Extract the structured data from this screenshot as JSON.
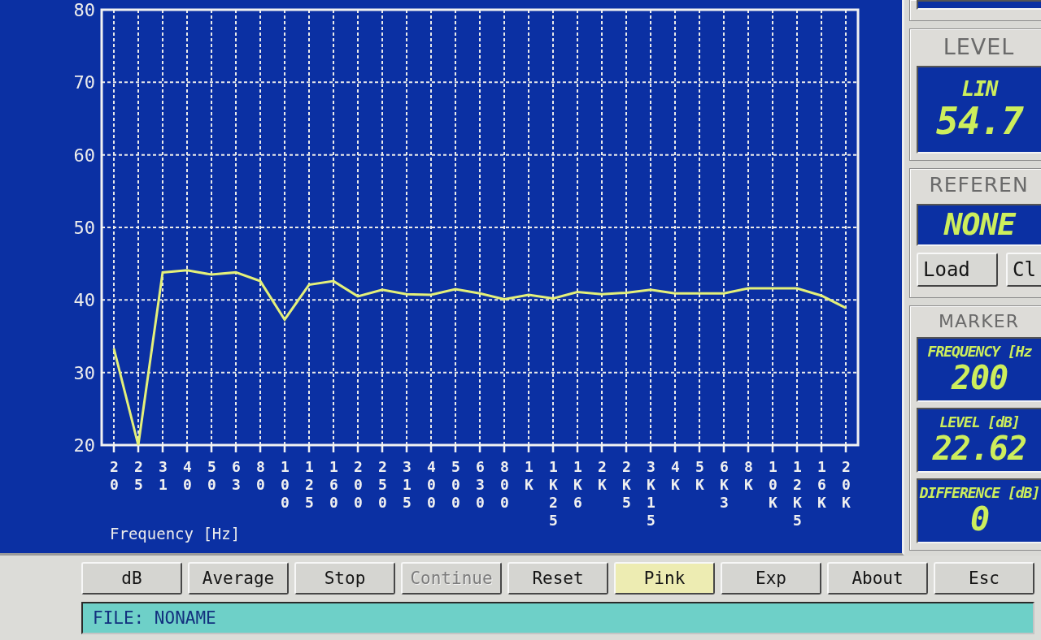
{
  "spectrum": {
    "chart_data": {
      "type": "line",
      "xlabel": "Frequency [Hz]",
      "categories": [
        "20",
        "25",
        "31",
        "40",
        "50",
        "63",
        "80",
        "100",
        "125",
        "160",
        "200",
        "250",
        "315",
        "400",
        "500",
        "630",
        "800",
        "1K",
        "1K25",
        "1K6",
        "2K",
        "2K5",
        "3K15",
        "4K",
        "5K",
        "6K3",
        "8K",
        "10K",
        "12K5",
        "16K",
        "20K"
      ],
      "series": [
        {
          "color": "#e4f07a",
          "values": [
            33.3,
            20,
            43.8,
            44.1,
            43.5,
            43.8,
            42.6,
            37.3,
            42.1,
            42.6,
            40.5,
            41.4,
            40.8,
            40.7,
            41.5,
            40.9,
            40.1,
            40.7,
            40.2,
            41.1,
            40.8,
            41.0,
            41.4,
            40.9,
            40.9,
            40.9,
            41.6,
            41.6,
            41.6,
            40.6,
            38.9
          ]
        }
      ],
      "ylim": [
        20,
        80
      ],
      "yticks": [
        20,
        30,
        40,
        50,
        60,
        70,
        80
      ],
      "grid": true
    }
  },
  "level_panel": {
    "title": "LEVEL",
    "mode": "LIN",
    "value": "54.7"
  },
  "reference_panel": {
    "title": "REFEREN",
    "value": "NONE",
    "buttons": [
      {
        "label": "Load"
      },
      {
        "label": "Cl"
      }
    ]
  },
  "marker_panel": {
    "title": "MARKER",
    "readouts": [
      {
        "label": "FREQUENCY [Hz",
        "value": "200"
      },
      {
        "label": "LEVEL [dB]",
        "value": "22.62"
      },
      {
        "label": "DIFFERENCE [dB]",
        "value": "0"
      }
    ]
  },
  "toolbar": {
    "buttons": [
      {
        "label": "dB",
        "selected": false,
        "disabled": false
      },
      {
        "label": "Average",
        "selected": false,
        "disabled": false
      },
      {
        "label": "Stop",
        "selected": false,
        "disabled": false
      },
      {
        "label": "Continue",
        "selected": false,
        "disabled": true
      },
      {
        "label": "Reset",
        "selected": false,
        "disabled": false
      },
      {
        "label": "Pink",
        "selected": true,
        "disabled": false
      },
      {
        "label": "Exp",
        "selected": false,
        "disabled": false
      },
      {
        "label": "About",
        "selected": false,
        "disabled": false
      },
      {
        "label": "Esc",
        "selected": false,
        "disabled": false
      }
    ]
  },
  "status_bar": {
    "text": "FILE: NONAME"
  }
}
